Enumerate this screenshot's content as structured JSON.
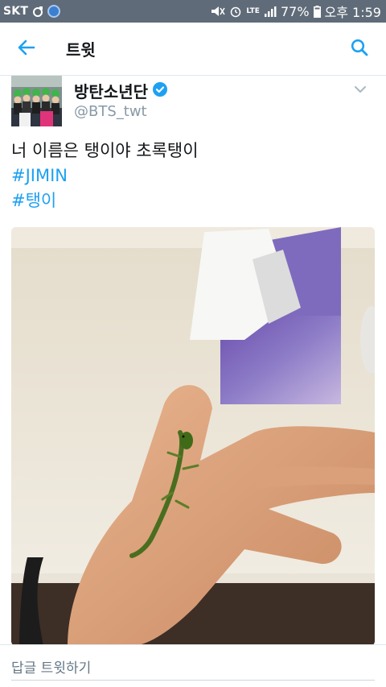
{
  "status_bar": {
    "carrier": "SKT",
    "network": "LTE",
    "battery": "77%",
    "time": "오후 1:59"
  },
  "app_bar": {
    "title": "트윗",
    "back_icon": "arrow-left-icon",
    "search_icon": "search-icon"
  },
  "tweet": {
    "user_name": "방탄소년단",
    "user_handle": "@BTS_twt",
    "verified_icon": "verified-badge-icon",
    "text": "너 이름은 탱이야 초록탱이",
    "hashtags": [
      "#JIMIN",
      "#탱이"
    ],
    "media_alt": "photo-hand-holding-green-gecko"
  },
  "reply": {
    "placeholder": "답글 트윗하기"
  },
  "colors": {
    "status_bar": "#5f6b78",
    "accent": "#1da1f2",
    "text_primary": "#14171a",
    "text_secondary": "#8899a6",
    "divider": "#e1e8ed"
  }
}
